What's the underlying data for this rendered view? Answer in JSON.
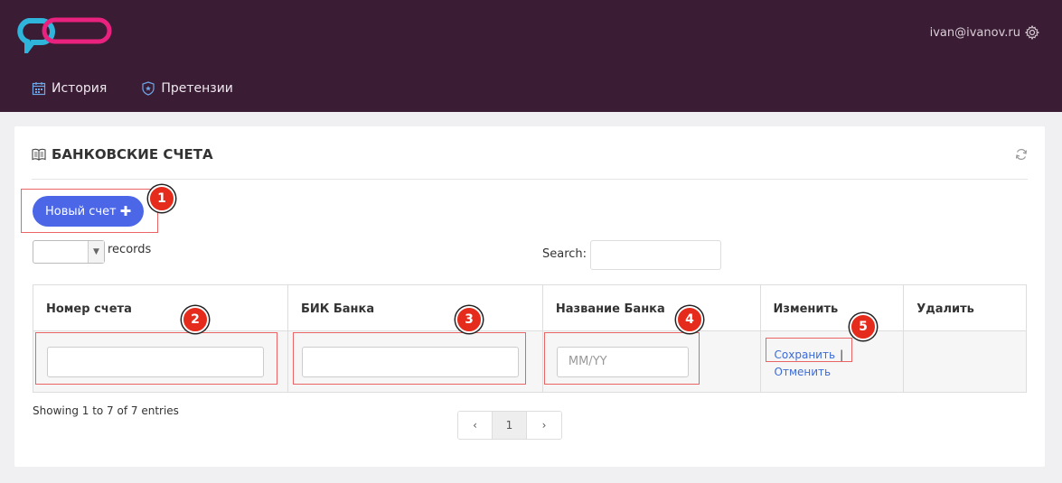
{
  "header": {
    "user_email": "ivan@ivanov.ru",
    "nav": [
      {
        "label": "История",
        "icon": "calendar-icon"
      },
      {
        "label": "Претензии",
        "icon": "shield-icon"
      }
    ]
  },
  "card": {
    "title": "БАНКОВСКИЕ СЧЕТА",
    "new_button_label": "Новый счет",
    "records_label": "records",
    "search_label": "Search:",
    "columns": [
      "Номер счета",
      "БИК Банка",
      "Название Банка",
      "Изменить",
      "Удалить"
    ],
    "row": {
      "account_value": "",
      "bik_value": "",
      "bank_name_placeholder": "MM/YY",
      "save_label": "Сохранить",
      "separator": "|",
      "cancel_label": "Отменить"
    },
    "showing_text": "Showing 1 to 7 of 7 entries",
    "pager": {
      "prev": "‹",
      "page": "1",
      "next": "›"
    }
  },
  "annotations": [
    "1",
    "2",
    "3",
    "4",
    "5"
  ],
  "colors": {
    "header_bg": "#3a1d34",
    "accent": "#4b67e8",
    "annotation": "#e52b1c"
  }
}
